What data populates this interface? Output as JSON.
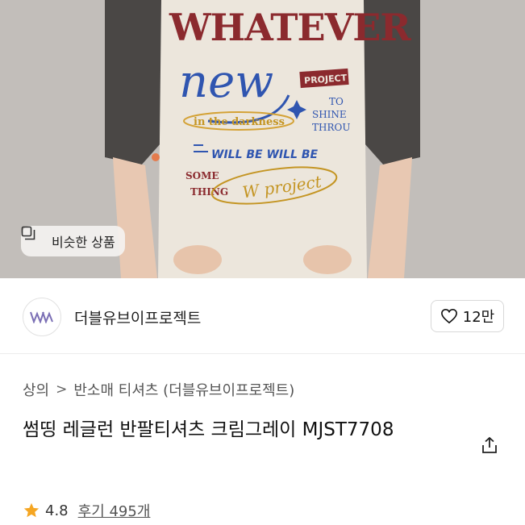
{
  "photo": {
    "alt_description": "",
    "shirt_graphic": {
      "headline": "WHATEVER",
      "script": "new",
      "badge": "PROJECT",
      "line1": "in the darkness",
      "line2_right": [
        "TO",
        "SHINE",
        "THROU"
      ],
      "line3": "WILL BE  WILL BE",
      "line4_left": [
        "SOME",
        "THING"
      ],
      "signature": "W project"
    },
    "similar_button_label": "비슷한 상품"
  },
  "brand": {
    "name": "더블유브이프로젝트",
    "logo_text": "WV",
    "likes_label": "12만"
  },
  "breadcrumb": {
    "category": "상의",
    "subcategory": "반소매 티셔츠 (더블유브이프로젝트)",
    "separator": ">"
  },
  "product": {
    "title": "썸띵 레글런 반팔티셔츠 크림그레이 MJST7708"
  },
  "rating": {
    "score": "4.8",
    "reviews_label": "후기 495개"
  },
  "colors": {
    "accent_star": "#f5a623",
    "shirt_body": "#ece6dc",
    "sleeve": "#4a4745"
  }
}
